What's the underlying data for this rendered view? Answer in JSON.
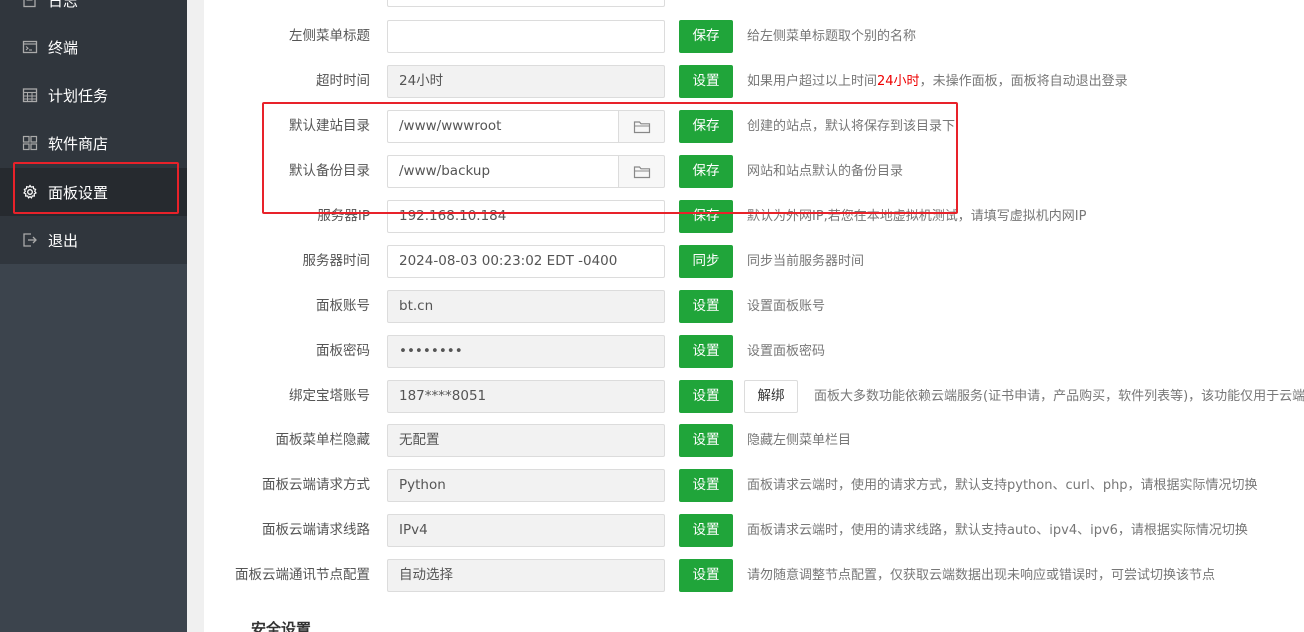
{
  "sidebar": {
    "items": [
      {
        "label": "日志",
        "icon": "log-icon"
      },
      {
        "label": "终端",
        "icon": "terminal-icon"
      },
      {
        "label": "计划任务",
        "icon": "calendar-icon"
      },
      {
        "label": "软件商店",
        "icon": "grid-icon"
      },
      {
        "label": "面板设置",
        "icon": "gear-icon",
        "active": true
      },
      {
        "label": "退出",
        "icon": "logout-icon"
      }
    ]
  },
  "settings": {
    "rows": [
      {
        "label": "左侧菜单标题",
        "value": "",
        "button": "保存",
        "hint": "给左侧菜单标题取个别的名称"
      },
      {
        "label": "超时时间",
        "value": "24小时",
        "button": "设置",
        "hint_pre": "如果用户超过以上时间",
        "hint_red": "24小时",
        "hint_post": "，未操作面板，面板将自动退出登录"
      },
      {
        "label": "默认建站目录",
        "value": "/www/wwwroot",
        "button": "保存",
        "hint": "创建的站点，默认将保存到该目录下"
      },
      {
        "label": "默认备份目录",
        "value": "/www/backup",
        "button": "保存",
        "hint": "网站和站点默认的备份目录"
      },
      {
        "label": "服务器IP",
        "value": "192.168.10.184",
        "button": "保存",
        "hint": "默认为外网IP,若您在本地虚拟机测试，请填写虚拟机内网IP"
      },
      {
        "label": "服务器时间",
        "value": "2024-08-03 00:23:02 EDT -0400",
        "button": "同步",
        "hint": "同步当前服务器时间"
      },
      {
        "label": "面板账号",
        "value": "bt.cn",
        "button": "设置",
        "hint": "设置面板账号"
      },
      {
        "label": "面板密码",
        "value": "••••••••",
        "button": "设置",
        "hint": "设置面板密码"
      },
      {
        "label": "绑定宝塔账号",
        "value": "187****8051",
        "button": "设置",
        "button2": "解绑",
        "hint": "面板大多数功能依赖云端服务(证书申请，产品购买，软件列表等)，该功能仅用于云端服"
      },
      {
        "label": "面板菜单栏隐藏",
        "value": "无配置",
        "button": "设置",
        "hint": "隐藏左侧菜单栏目"
      },
      {
        "label": "面板云端请求方式",
        "value": "Python",
        "button": "设置",
        "hint": "面板请求云端时，使用的请求方式，默认支持python、curl、php，请根据实际情况切换"
      },
      {
        "label": "面板云端请求线路",
        "value": "IPv4",
        "button": "设置",
        "hint": "面板请求云端时，使用的请求线路，默认支持auto、ipv4、ipv6，请根据实际情况切换"
      },
      {
        "label": "面板云端通讯节点配置",
        "value": "自动选择",
        "button": "设置",
        "hint": "请勿随意调整节点配置，仅获取云端数据出现未响应或错误时，可尝试切换该节点"
      }
    ],
    "section_title": "安全设置"
  },
  "colors": {
    "accent": "#20a53a",
    "highlight": "#e8222a",
    "sidebar_bg": "#3c444d"
  }
}
